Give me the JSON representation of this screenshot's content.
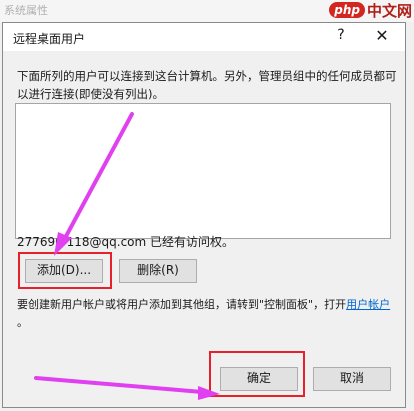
{
  "background": {
    "window_title": "系统属性",
    "watermark": {
      "badge": "php",
      "text": "中文网"
    }
  },
  "dialog": {
    "title": "远程桌面用户",
    "help_glyph": "?",
    "close_glyph": "✕",
    "description": "下面所列的用户可以连接到这台计算机。另外，管理员组中的任何成员都可以进行连接(即使没有列出)。",
    "users": [],
    "access_text": "277690   118@qq.com 已经有访问权。",
    "add_button": "添加(D)...",
    "remove_button": "删除(R)",
    "note_text": "要创建新用户帐户或将用户添加到其他组，请转到\"控制面板\"，打开",
    "note_link": "用户帐户",
    "note_end": "。",
    "ok_button": "确定",
    "cancel_button": "取消"
  },
  "colors": {
    "highlight_box": "#e8202b",
    "arrow": "#e040f0",
    "link": "#0066cc"
  }
}
